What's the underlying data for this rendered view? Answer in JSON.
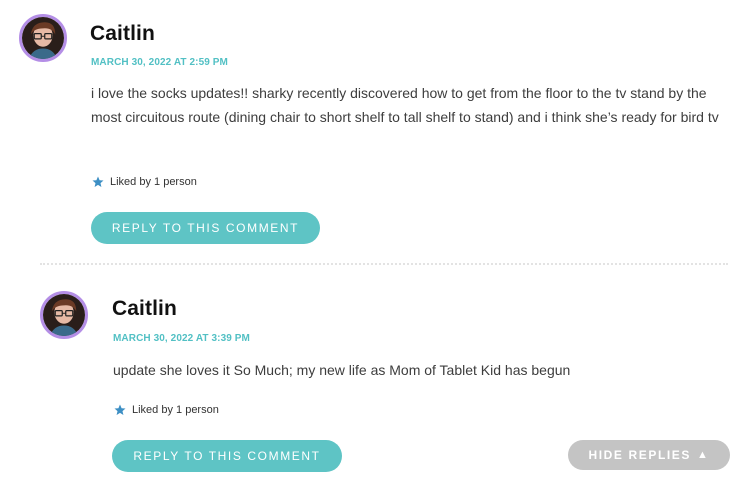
{
  "comments": [
    {
      "author": "Caitlin",
      "timestamp": "MARCH 30, 2022 AT 2:59 PM",
      "text": "i love the socks updates!! sharky recently discovered how to get from the floor to the tv stand by the most circuitous route (dining chair to short shelf to tall shelf to stand) and i think she’s ready for bird tv",
      "likes": "Liked by 1 person",
      "reply_label": "REPLY TO THIS COMMENT"
    },
    {
      "author": "Caitlin",
      "timestamp": "MARCH 30, 2022 AT 3:39 PM",
      "text": "update she loves it So Much; my new life as Mom of Tablet Kid has begun",
      "likes": "Liked by 1 person",
      "reply_label": "REPLY TO THIS COMMENT"
    }
  ],
  "hide_replies": {
    "label": "HIDE REPLIES",
    "arrow": "▲"
  },
  "icons": {
    "like": "star-icon",
    "collapse": "triangle-up-icon"
  },
  "colors": {
    "accent": "#5ec4c5",
    "timestamp": "#52c0c4",
    "avatar_ring": "#b48ee6",
    "hide_button": "#c4c4c4"
  }
}
